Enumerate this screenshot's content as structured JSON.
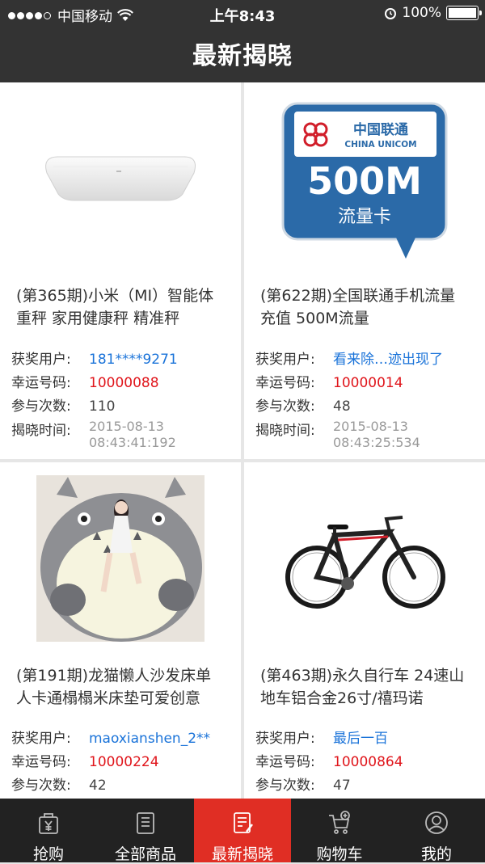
{
  "status_bar": {
    "carrier": "中国移动",
    "time": "上午8:43",
    "battery": "100%"
  },
  "header": {
    "title": "最新揭晓"
  },
  "labels": {
    "winner": "获奖用户:",
    "lucky": "幸运号码:",
    "count": "参与次数:",
    "time": "揭晓时间:"
  },
  "items": [
    {
      "name": "(第365期)小米（MI）智能体重秤 家用健康秤 精准秤",
      "winner": "181****9271",
      "lucky": "10000088",
      "count": "110",
      "date": "2015-08-13",
      "clock": "08:43:41:192",
      "image_icon": "smart-scale-image"
    },
    {
      "name": "(第622期)全国联通手机流量充值 500M流量",
      "winner": "看来除…迹出现了",
      "lucky": "10000014",
      "count": "48",
      "date": "2015-08-13",
      "clock": "08:43:25:534",
      "image_icon": "unicom-data-card-image",
      "badge": {
        "cn": "中国联通",
        "en": "CHINA UNICOM",
        "amount": "500M",
        "sub": "流量卡"
      }
    },
    {
      "name": "(第191期)龙猫懒人沙发床单人卡通榻榻米床垫可爱创意",
      "winner": "maoxianshen_2**",
      "lucky": "10000224",
      "count": "42",
      "image_icon": "totoro-sofa-bed-image"
    },
    {
      "name": "(第463期)永久自行车 24速山地车铝合金26寸/禧玛诺",
      "winner": "最后一百",
      "lucky": "10000864",
      "count": "47",
      "image_icon": "mountain-bike-image"
    }
  ],
  "tabs": [
    {
      "label": "抢购",
      "icon": "yuan-bag-icon"
    },
    {
      "label": "全部商品",
      "icon": "catalog-icon"
    },
    {
      "label": "最新揭晓",
      "icon": "announcement-icon",
      "active": true
    },
    {
      "label": "购物车",
      "icon": "cart-icon"
    },
    {
      "label": "我的",
      "icon": "user-icon"
    }
  ],
  "colors": {
    "header_bg": "#333333",
    "tab_active": "#e02e24",
    "winner_text": "#1a73d9",
    "lucky_text": "#e0151b"
  }
}
